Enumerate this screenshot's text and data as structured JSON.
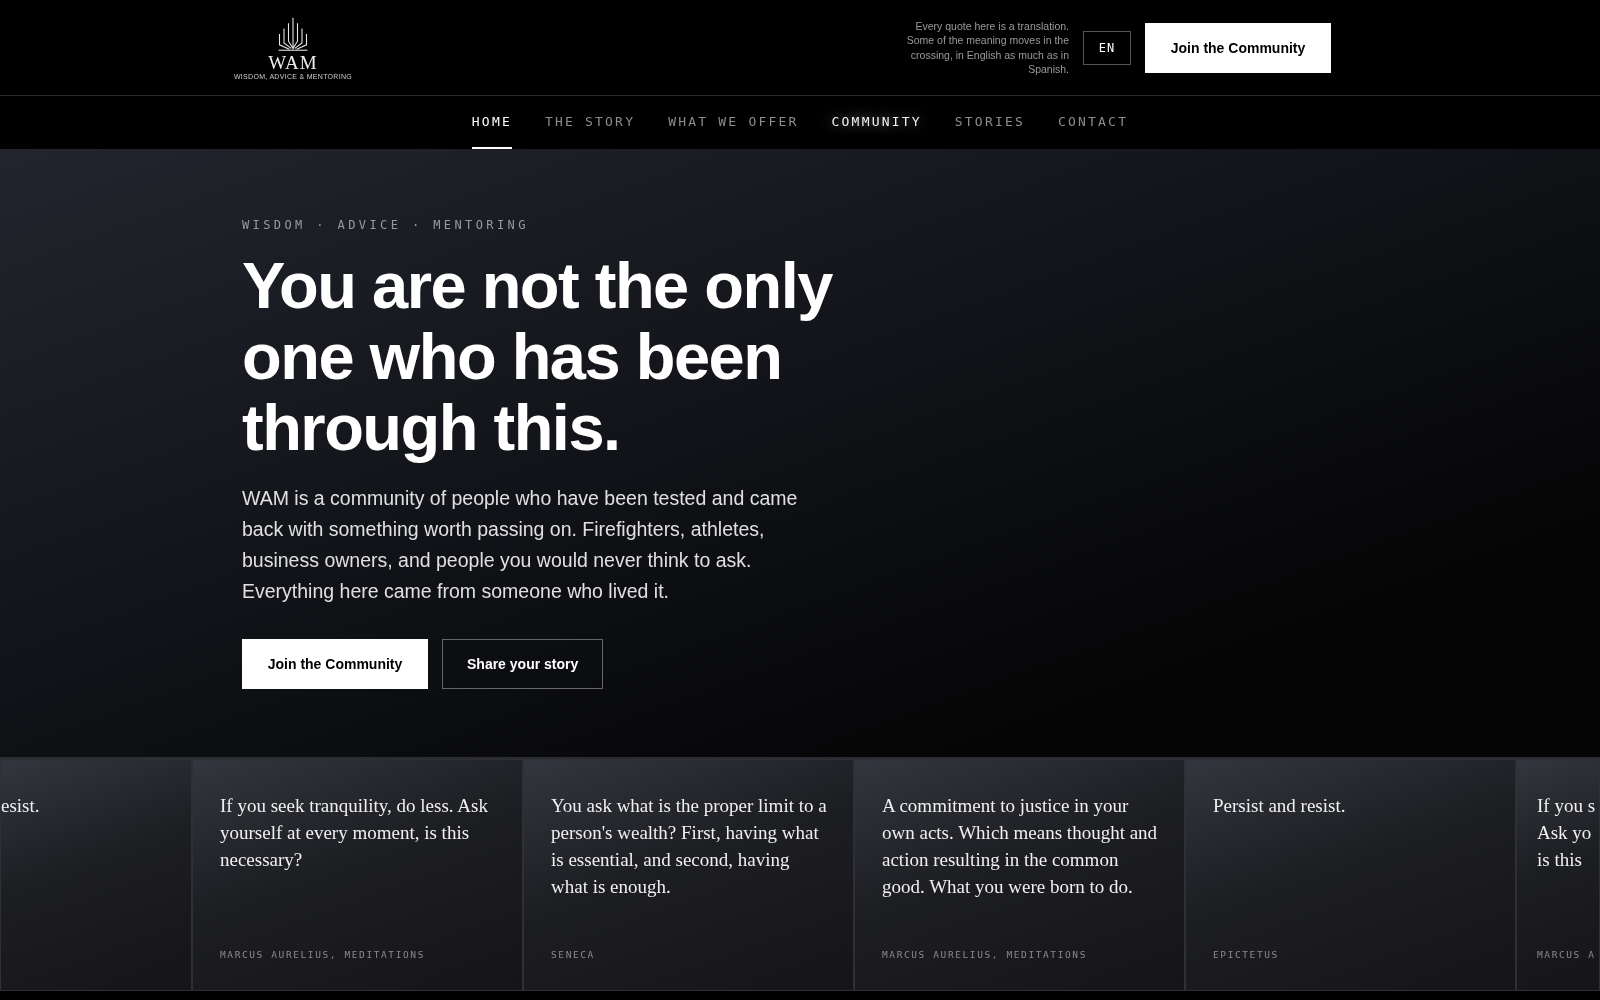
{
  "header": {
    "logo": {
      "name": "WAM",
      "tagline": "WISDOM, ADVICE & MENTORING"
    },
    "translation_note": "Every quote here is a translation. Some of the meaning moves in the crossing, in English as much as in Spanish.",
    "language": "EN",
    "cta": "Join the Community"
  },
  "nav": [
    {
      "label": "HOME",
      "selected": true,
      "highlighted": false
    },
    {
      "label": "THE STORY",
      "selected": false,
      "highlighted": false
    },
    {
      "label": "WHAT WE OFFER",
      "selected": false,
      "highlighted": false
    },
    {
      "label": "COMMUNITY",
      "selected": false,
      "highlighted": true
    },
    {
      "label": "STORIES",
      "selected": false,
      "highlighted": false
    },
    {
      "label": "CONTACT",
      "selected": false,
      "highlighted": false
    }
  ],
  "hero": {
    "eyebrow": "WISDOM · ADVICE · MENTORING",
    "heading": "You are not the only one who has been through this.",
    "body": "WAM is a community of people who have been tested and came back with something worth passing on. Firefighters, athletes, business owners, and people you would never think to ask. Everything here came from someone who lived it.",
    "buttons": [
      {
        "label": "Join the Community",
        "kind": "primary"
      },
      {
        "label": "Share your story",
        "kind": "outline"
      }
    ]
  },
  "quotes": [
    {
      "kind": "cut-left",
      "lines": [
        "esist."
      ]
    },
    {
      "kind": "full",
      "quote": "If you seek tranquility, do less. Ask yourself at every moment, is this necessary?",
      "author": "MARCUS AURELIUS, MEDITATIONS"
    },
    {
      "kind": "full",
      "quote": "You ask what is the proper limit to a person's wealth? First, having what is essential, and second, having what is enough.",
      "author": "SENECA"
    },
    {
      "kind": "full",
      "quote": "A commitment to justice in your own acts. Which means thought and action resulting in the common good. What you were born to do.",
      "author": "MARCUS AURELIUS, MEDITATIONS"
    },
    {
      "kind": "full",
      "quote": "Persist and resist.",
      "author": "EPICTETUS"
    },
    {
      "kind": "cut-right",
      "lines": [
        "If you s",
        "Ask yo",
        "is this"
      ],
      "author": "MARCUS A"
    }
  ]
}
